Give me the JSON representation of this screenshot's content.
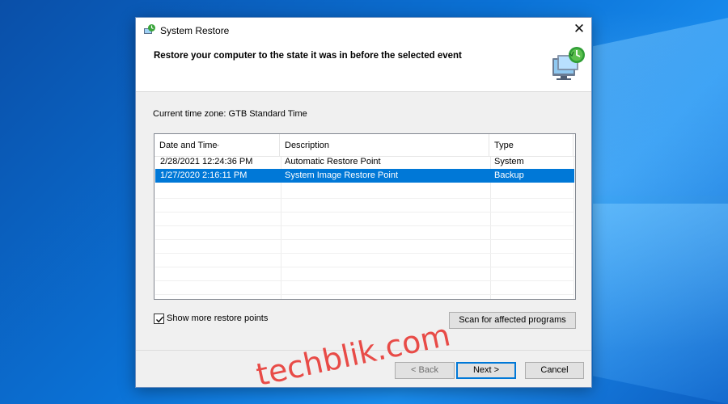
{
  "window": {
    "title": "System Restore",
    "close_glyph": "✕"
  },
  "header": {
    "instruction": "Restore your computer to the state it was in before the selected event"
  },
  "timezone_label": "Current time zone: GTB Standard Time",
  "restore_points": {
    "columns": [
      "Date and Time",
      "Description",
      "Type"
    ],
    "rows": [
      {
        "date": "2/28/2021 12:24:36 PM",
        "description": "Automatic Restore Point",
        "type": "System",
        "selected": false
      },
      {
        "date": "1/27/2020 2:16:11 PM",
        "description": "System Image Restore Point",
        "type": "Backup",
        "selected": true
      }
    ]
  },
  "show_more": {
    "label": "Show more restore points",
    "checked": true
  },
  "buttons": {
    "scan": "Scan for affected programs",
    "back": "< Back",
    "next": "Next >",
    "cancel": "Cancel"
  },
  "watermark": "techblik.com",
  "colors": {
    "selection": "#0078d7",
    "watermark": "#e8433f",
    "desktop": "#0b72d6"
  }
}
